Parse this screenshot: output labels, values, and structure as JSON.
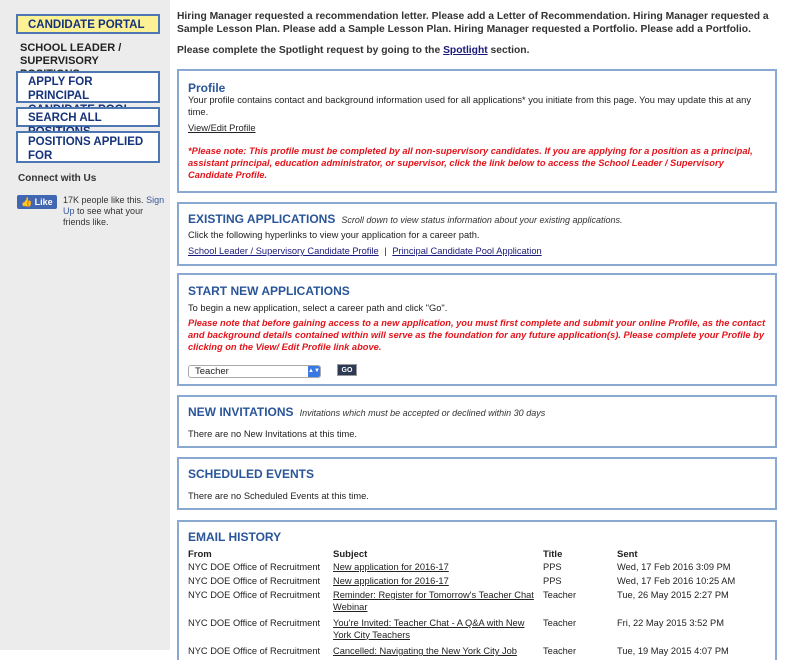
{
  "sidebar": {
    "candidate_portal": "CANDIDATE PORTAL",
    "school_leader": "SCHOOL LEADER / SUPERVISORY POSITIONS",
    "apply_principal": "APPLY FOR PRINCIPAL CANDIDATE POOL",
    "search_all": "SEARCH ALL POSITIONS",
    "positions_applied": "POSITIONS APPLIED FOR",
    "connect": "Connect with Us",
    "like_label": "Like",
    "like_text_pre": "17K people like this.",
    "like_signup": "Sign Up",
    "like_text_post": "to see what your friends like."
  },
  "notices": {
    "line1": "Hiring Manager requested a recommendation letter. Please add a Letter of Recommendation. Hiring Manager requested a Sample Lesson Plan. Please add a Sample Lesson Plan. Hiring Manager requested a Portfolio. Please add a Portfolio.",
    "line2_pre": "Please complete the Spotlight request by going to the",
    "line2_link": "Spotlight",
    "line2_post": "section."
  },
  "profile": {
    "title": "Profile",
    "desc": "Your profile contains contact and background information used for all applications* you initiate from this page. You may update this at any time.",
    "link": "View/Edit Profile",
    "note": "*Please note: This profile must be completed by all non-supervisory candidates. If you are applying for a position as a principal, assistant principal, education administrator, or supervisor, click the link below to access the School Leader / Supervisory Candidate Profile."
  },
  "existing": {
    "title": "EXISTING APPLICATIONS",
    "subtitle": "Scroll down to view status information about your existing applications.",
    "desc": "Click the following hyperlinks to view your application for a career path.",
    "link1": "School Leader / Supervisory Candidate Profile",
    "sep": "|",
    "link2": "Principal Candidate Pool Application"
  },
  "start_new": {
    "title": "START NEW APPLICATIONS",
    "desc": "To begin a new application, select a career path and click \"Go\".",
    "note": "Please note that before gaining access to a new application, you must first complete and submit your online Profile, as the contact and background details contained within will serve as the foundation for any future application(s). Please complete your Profile by clicking on the View/ Edit Profile link above.",
    "select_value": "Teacher",
    "go_label": "GO"
  },
  "invitations": {
    "title": "NEW INVITATIONS",
    "subtitle": "Invitations which must be accepted or declined within 30 days",
    "empty": "There are no New Invitations at this time."
  },
  "events": {
    "title": "SCHEDULED EVENTS",
    "empty": "There are no Scheduled Events at this time."
  },
  "email_history": {
    "title": "EMAIL HISTORY",
    "columns": [
      "From",
      "Subject",
      "Title",
      "Sent"
    ],
    "rows": [
      {
        "from": "NYC DOE Office of Recruitment",
        "subject": "New application for 2016-17",
        "title": "PPS",
        "sent": "Wed, 17 Feb 2016 3:09 PM"
      },
      {
        "from": "NYC DOE Office of Recruitment",
        "subject": "New application for 2016-17",
        "title": "PPS",
        "sent": "Wed, 17 Feb 2016 10:25 AM"
      },
      {
        "from": "NYC DOE Office of Recruitment",
        "subject": "Reminder: Register for Tomorrow's Teacher Chat Webinar",
        "title": "Teacher",
        "sent": "Tue, 26 May 2015 2:27 PM"
      },
      {
        "from": "NYC DOE Office of Recruitment",
        "subject": "You're Invited: Teacher Chat - A Q&A with New York City Teachers",
        "title": "Teacher",
        "sent": "Fri, 22 May 2015 3:52 PM"
      },
      {
        "from": "NYC DOE Office of Recruitment",
        "subject": "Cancelled: Navigating the New York City Job",
        "title": "Teacher",
        "sent": "Tue, 19 May 2015 4:07 PM"
      }
    ]
  }
}
